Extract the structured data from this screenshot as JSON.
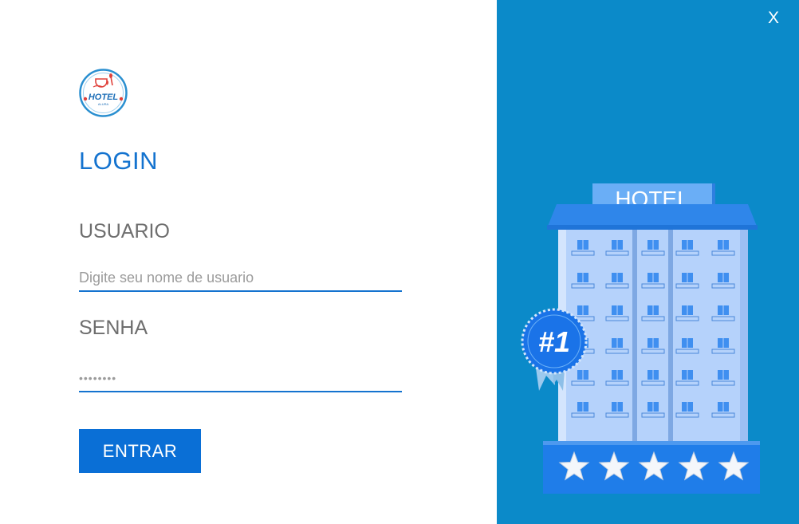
{
  "logo": {
    "text": "HOTEL",
    "subtext": "ALURA"
  },
  "login": {
    "title": "LOGIN",
    "username_label": "USUARIO",
    "username_placeholder": "Digite seu nome de usuario",
    "password_label": "SENHA",
    "password_value": "••••••••",
    "submit_label": "ENTRAR"
  },
  "window": {
    "close_label": "X"
  },
  "illustration": {
    "sign_text": "HOTEL",
    "badge_text": "#1",
    "stars": 5
  },
  "colors": {
    "accent": "#1473cf",
    "button": "#0a6fd6",
    "side_panel": "#0b8ac9",
    "label_gray": "#6e6e6e"
  }
}
